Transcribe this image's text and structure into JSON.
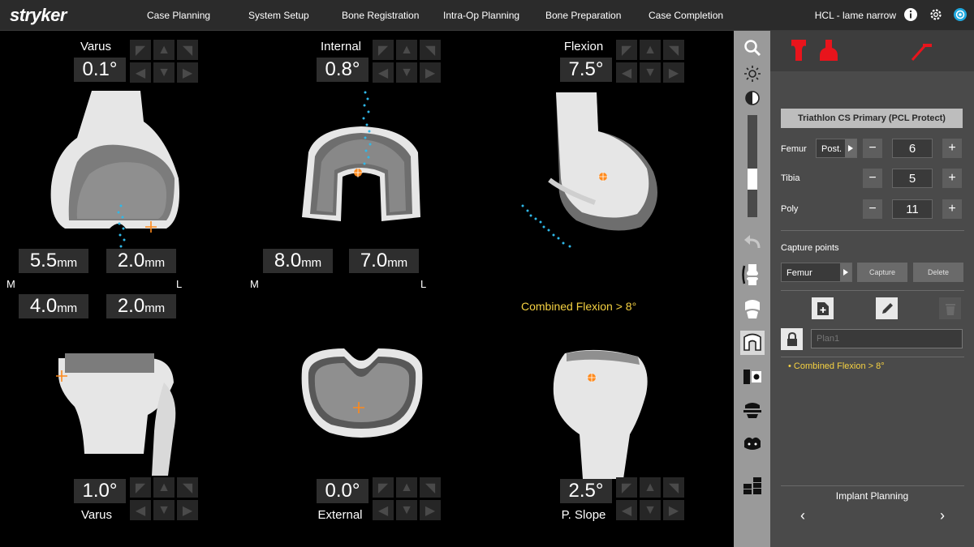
{
  "header": {
    "logo": "stryker",
    "tabs": [
      "Case Planning",
      "System Setup",
      "Bone Registration",
      "Intra-Op Planning",
      "Bone Preparation",
      "Case Completion"
    ],
    "case_name": "HCL - lame narrow"
  },
  "views": {
    "femur_front": {
      "label": "Varus",
      "value": "0.1°"
    },
    "femur_axial": {
      "label": "Internal",
      "value": "0.8°"
    },
    "femur_lateral": {
      "label": "Flexion",
      "value": "7.5°"
    },
    "tibia_front": {
      "label": "Varus",
      "value": "1.0°"
    },
    "tibia_axial": {
      "label": "External",
      "value": "0.0°"
    },
    "tibia_lateral": {
      "label": "P. Slope",
      "value": "2.5°"
    }
  },
  "gaps": {
    "femur_front_medial_1": "5.5",
    "femur_front_lateral_1": "2.0",
    "femur_front_medial_2": "4.0",
    "femur_front_lateral_2": "2.0",
    "femur_axial_medial": "8.0",
    "femur_axial_lateral": "7.0",
    "unit": "mm",
    "medial_label": "M",
    "lateral_label": "L"
  },
  "warning_main": "Combined Flexion > 8°",
  "panel": {
    "implant": "Triathlon CS Primary (PCL Protect)",
    "femur_label": "Femur",
    "femur_option": "Post.",
    "femur_size": "6",
    "tibia_label": "Tibia",
    "tibia_size": "5",
    "poly_label": "Poly",
    "poly_size": "11",
    "minus": "−",
    "plus": "+",
    "capture_title": "Capture points",
    "capture_select": "Femur",
    "capture_btn": "Capture",
    "delete_btn": "Delete",
    "plan_placeholder": "Plan1",
    "warning_item": "• Combined Flexion > 8°",
    "footer_title": "Implant Planning",
    "prev": "‹",
    "next": "›"
  },
  "colors": {
    "accent_red": "#e8141c",
    "warning_yellow": "#f5d142",
    "marker_orange": "#ff8a1c",
    "point_cyan": "#2fb8e8"
  }
}
